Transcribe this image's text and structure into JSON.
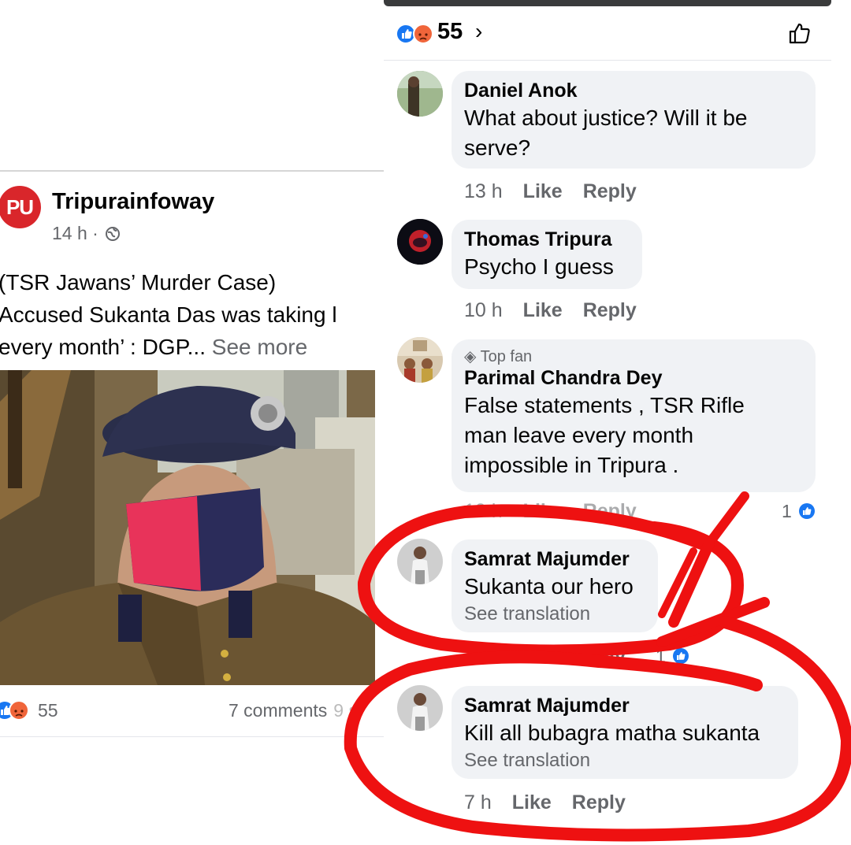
{
  "post": {
    "page_name": "Tripurainfoway",
    "logo_text": "PU",
    "time": "14 h",
    "separator": "·",
    "text_lines": [
      "(TSR Jawans’ Murder Case)",
      "Accused Sukanta Das was taking l",
      "every month’ : DGP..."
    ],
    "see_more": "See more",
    "reaction_count": "55",
    "comments_count": "7 comments",
    "shares_fragment": "9 s"
  },
  "comments_panel": {
    "reaction_count": "55",
    "chevron": "›",
    "comments": [
      {
        "name": "Daniel Anok",
        "text_lines": [
          "What about justice? Will it be",
          "serve?"
        ],
        "time": "13 h",
        "like": "Like",
        "reply": "Reply"
      },
      {
        "name": "Thomas Tripura",
        "text_lines": [
          "Psycho I guess"
        ],
        "time": "10 h",
        "like": "Like",
        "reply": "Reply"
      },
      {
        "badge": "Top fan",
        "name": "Parimal Chandra Dey",
        "text_lines": [
          "False statements , TSR Rifle",
          "man leave every month",
          "impossible in Tripura ."
        ],
        "time": "10 h",
        "like": "Like",
        "reply": "Reply",
        "reaction_count": "1"
      },
      {
        "name": "Samrat Majumder",
        "text_lines": [
          "Sukanta our hero"
        ],
        "translation": "See translation",
        "time": "7 h",
        "like": "Like",
        "reply": "Reply",
        "reaction_count": "1"
      },
      {
        "name": "Samrat Majumder",
        "text_lines": [
          "Kill all bubagra matha sukanta"
        ],
        "translation": "See translation",
        "time": "7 h",
        "like": "Like",
        "reply": "Reply"
      }
    ]
  },
  "colors": {
    "like_blue": "#1877f2",
    "angry_orange": "#f0653a",
    "annotation_red": "#ee1111",
    "bubble_gray": "#f0f2f5",
    "meta_gray": "#65676b"
  },
  "icons": [
    "like-reaction-icon",
    "angry-reaction-icon",
    "globe-icon",
    "thumbs-up-outline-icon",
    "top-fan-badge-icon"
  ]
}
